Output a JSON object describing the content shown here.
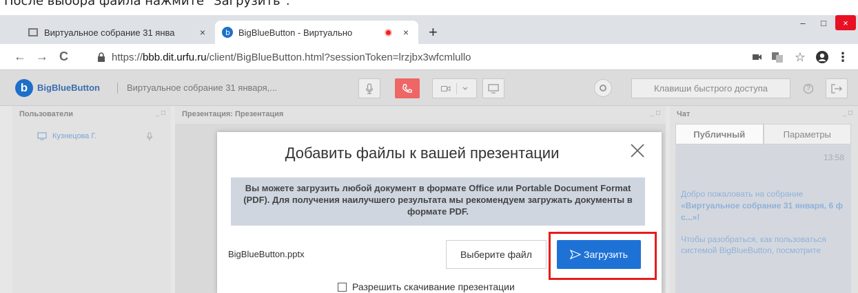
{
  "caption": "После выбора файла нажмите \"Загрузить\".",
  "browser": {
    "tabs": [
      {
        "title": "Виртуальное собрание 31 янва",
        "close": "×"
      },
      {
        "title": "BigBlueButton - Виртуально",
        "close": "×"
      }
    ],
    "new_tab": "+",
    "window_controls": {
      "minimize": "–",
      "maximize": "□",
      "close": "×"
    },
    "url_prefix": "https://",
    "url_host": "bbb.dit.urfu.ru",
    "url_path": "/client/BigBlueButton.html?sessionToken=lrzjbx3wfcmlullo",
    "nav": {
      "back": "←",
      "forward": "→",
      "reload": "C"
    }
  },
  "app": {
    "logo_letter": "b",
    "brand": "BigBlueButton",
    "meeting_title": "Виртуальное собрание 31 января,...",
    "shortcuts_label": "Клавиши быстрого доступа",
    "users_panel": {
      "title": "Пользователи",
      "controls": "_ □",
      "user_name": "Кузнецова Г."
    },
    "presentation_panel": {
      "title": "Презентация: Презентация",
      "controls": "_ □"
    },
    "chat_panel": {
      "title": "Чат",
      "controls": "_ □",
      "tabs": [
        "Публичный",
        "Параметры"
      ],
      "time": "13:58",
      "welcome_prefix": "Добро пожаловать на собрание",
      "welcome_bold": "«Виртуальное собрание 31 января, 6 ф с...»!",
      "help": "Чтобы разобраться, как пользоваться системой BigBlueButton, посмотрите"
    }
  },
  "modal": {
    "title": "Добавить файлы к вашей презентации",
    "info": "Вы можете загрузить любой документ в формате Office или Portable Document Format (PDF). Для получения наилучшего результата мы рекомендуем загружать документы в формате PDF.",
    "file_name": "BigBlueButton.pptx",
    "choose_label": "Выберите файл",
    "upload_label": "Загрузить",
    "allow_download_label": "Разрешить скачивание презентации",
    "allow_download_checked": false
  },
  "colors": {
    "highlight": "#e81b1b",
    "upload_bg": "#1e72d6",
    "brand": "#1e6fc9"
  }
}
